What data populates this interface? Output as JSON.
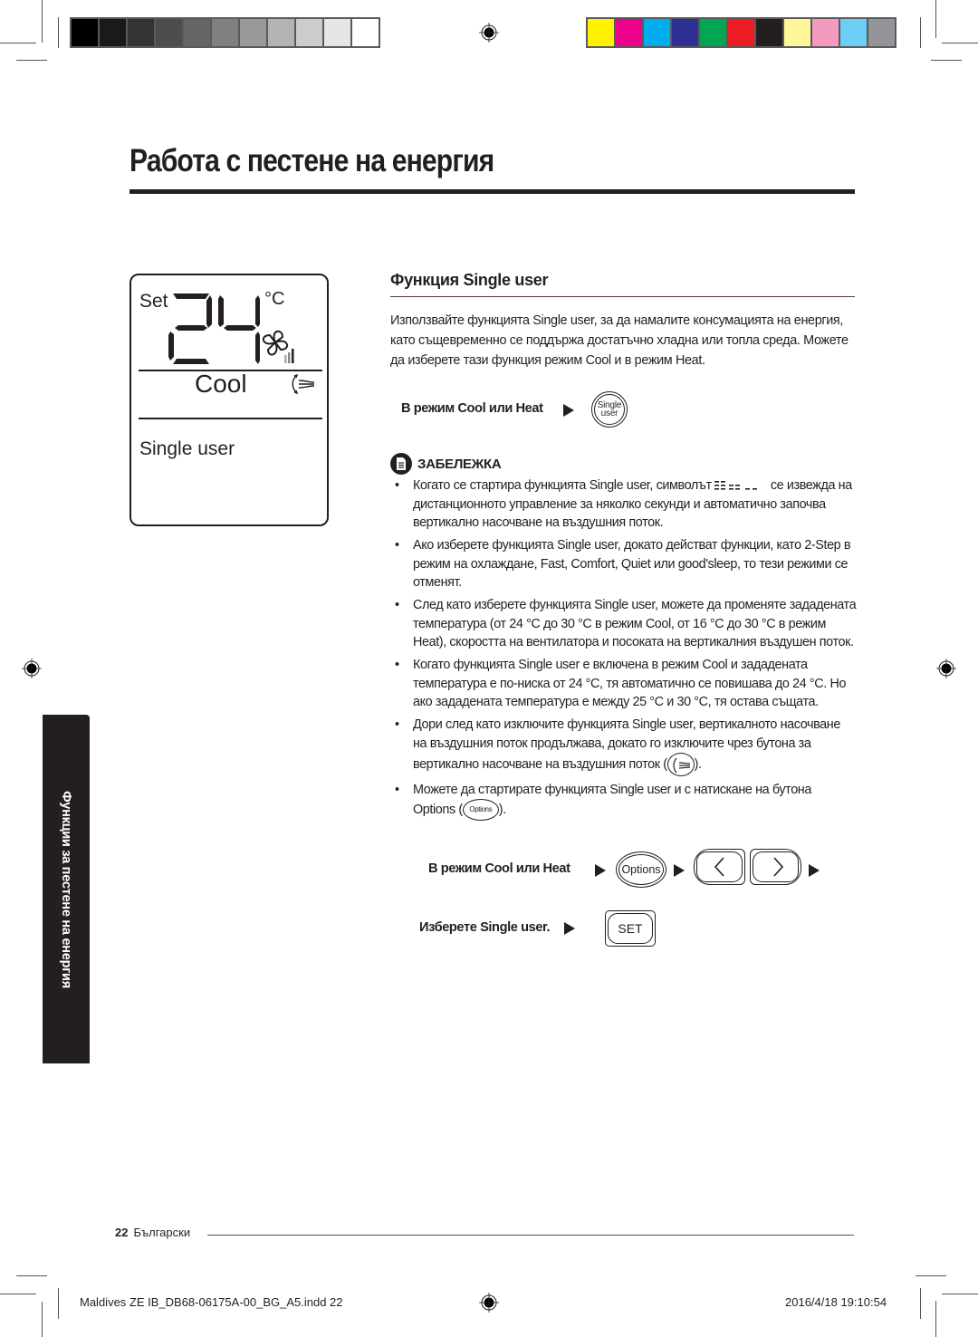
{
  "print_marks": {
    "gray_swatches": [
      "#000000",
      "#1a1a1a",
      "#333333",
      "#4d4d4d",
      "#666666",
      "#808080",
      "#999999",
      "#b3b3b3",
      "#cccccc",
      "#e6e6e6",
      "#ffffff"
    ],
    "color_swatches": [
      "#fff200",
      "#ec008c",
      "#00aeef",
      "#2e3192",
      "#00a651",
      "#ed1c24",
      "#231f20",
      "#fff799",
      "#f49ac1",
      "#6dcff6",
      "#939598"
    ]
  },
  "page": {
    "title": "Работа с пестене на енергия",
    "side_tab": "Функции за пестене на енергия"
  },
  "display": {
    "set_label": "Set",
    "temperature": "24",
    "unit": "°C",
    "mode": "Cool",
    "function": "Single user"
  },
  "section": {
    "title": "Функция Single user",
    "intro": "Използвайте функцията Single user, за да намалите консумацията на енергия, като същевременно се поддържа достатъчно хладна или топла среда. Можете да изберете тази функция режим Cool и в режим Heat.",
    "step1": {
      "label": "В режим Cool или Heat",
      "button_line1": "Single",
      "button_line2": "user"
    }
  },
  "note": {
    "title": "ЗАБЕЛЕЖКА",
    "bullets": [
      {
        "before": "Когато се стартира функцията Single user, символът ",
        "after": " се извежда на дистанционното управление за няколко секунди и автоматично започва вертикално насочване на въздушния поток."
      },
      {
        "text": "Ако изберете функцията Single user, докато действат функции, като 2-Step в режим на охлаждане, Fast, Comfort, Quiet или good'sleep, то тези режими се отменят."
      },
      {
        "text": "След като изберете функцията Single user, можете да променяте зададената температура (от 24 °C до 30 °C в режим Cool, от 16 °C до 30 °C в режим Heat), скоростта на вентилатора и посоката на вертикалния въздушен поток."
      },
      {
        "text": "Когато функцията Single user е включена в режим Cool и зададената температура е по-ниска от 24 °C, тя автоматично се повишава до 24 °C. Но ако зададената температура е между 25 °C и 30 °C, тя остава същата."
      },
      {
        "before": "Дори след като изключите функцията Single user, вертикалното насочване на въздушния поток продължава, докато го изключите чрез бутона за вертикално насочване на въздушния поток (",
        "after": ")."
      },
      {
        "before": "Можете да стартирате функцията Single user и с натискане на бутона Options (",
        "button": "Options",
        "after": ")."
      }
    ]
  },
  "steps2": {
    "row1_label": "В режим Cool или Heat",
    "options_button": "Options",
    "row2_label": "Изберете Single user.",
    "set_button": "SET"
  },
  "footer": {
    "page_number": "22",
    "language": "Български",
    "slug_file": "Maldives ZE IB_DB68-06175A-00_BG_A5.indd   22",
    "slug_date": "2016/4/18   19:10:54"
  }
}
